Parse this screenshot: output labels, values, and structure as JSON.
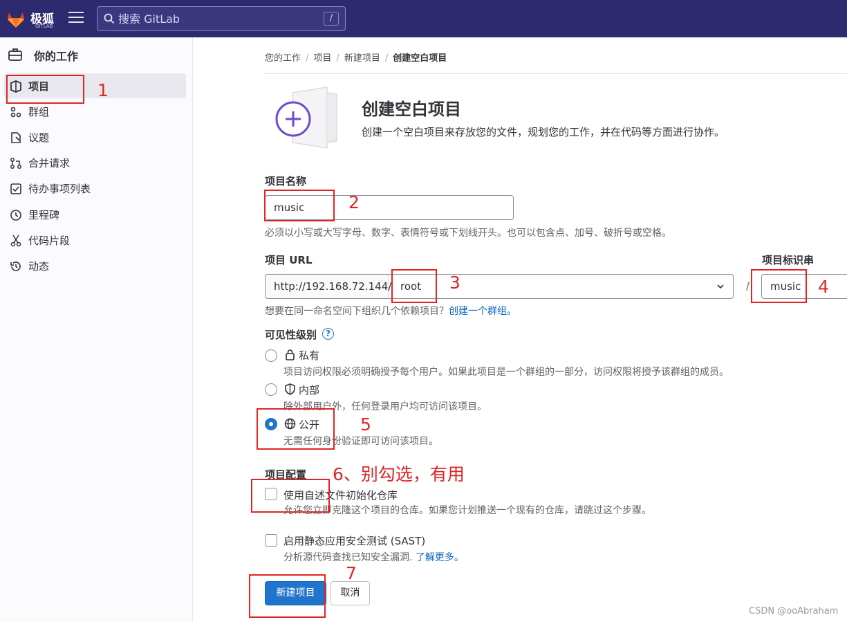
{
  "topbar": {
    "brand": "极狐",
    "brand_sub": "GITLAB",
    "search_placeholder": "搜索 GitLab",
    "search_shortcut": "/"
  },
  "sidebar": {
    "title": "你的工作",
    "items": [
      {
        "label": "项目",
        "icon": "project-icon",
        "active": true
      },
      {
        "label": "群组",
        "icon": "group-icon"
      },
      {
        "label": "议题",
        "icon": "issues-icon"
      },
      {
        "label": "合并请求",
        "icon": "merge-request-icon"
      },
      {
        "label": "待办事项列表",
        "icon": "todo-icon"
      },
      {
        "label": "里程碑",
        "icon": "milestone-icon"
      },
      {
        "label": "代码片段",
        "icon": "snippet-icon"
      },
      {
        "label": "动态",
        "icon": "history-icon"
      }
    ]
  },
  "breadcrumb": [
    "您的工作",
    "项目",
    "新建项目",
    "创建空白项目"
  ],
  "page": {
    "title": "创建空白项目",
    "description": "创建一个空白项目来存放您的文件，规划您的工作，并在代码等方面进行协作。"
  },
  "form": {
    "name_label": "项目名称",
    "name_value": "music",
    "name_help": "必须以小写或大写字母、数字、表情符号或下划线开头。也可以包含点、加号、破折号或空格。",
    "url_label": "项目 URL",
    "url_prefix": "http://192.168.72.144/",
    "url_namespace": "root",
    "url_separator": "/",
    "slug_label": "项目标识串",
    "slug_value": "music",
    "url_help": "想要在同一命名空间下组织几个依赖项目？",
    "url_help_link": "创建一个群组。",
    "visibility_label": "可见性级别",
    "visibility_help_icon": "?",
    "visibility": [
      {
        "label": "私有",
        "icon": "lock-icon",
        "desc": "项目访问权限必须明确授予每个用户。如果此项目是一个群组的一部分，访问权限将授予该群组的成员。",
        "checked": false
      },
      {
        "label": "内部",
        "icon": "shield-icon",
        "desc": "除外部用户外，任何登录用户均可访问该项目。",
        "checked": false
      },
      {
        "label": "公开",
        "icon": "globe-icon",
        "desc": "无需任何身份验证即可访问该项目。",
        "checked": true
      }
    ],
    "config_label": "项目配置",
    "init_readme_label": "使用自述文件初始化仓库",
    "init_readme_desc": "允许您立即克隆这个项目的仓库。如果您计划推送一个现有的仓库，请跳过这个步骤。",
    "init_readme_checked": false,
    "sast_label": "启用静态应用安全测试 (SAST)",
    "sast_desc": "分析源代码查找已知安全漏洞.",
    "sast_link": "了解更多。",
    "sast_checked": false,
    "submit_label": "新建项目",
    "cancel_label": "取消"
  },
  "annotations": [
    "1",
    "2",
    "3",
    "4",
    "5",
    "6、别勾选，有用",
    "7"
  ],
  "watermark": "CSDN @ooAbraham",
  "colors": {
    "topbar": "#2e2a70",
    "primary": "#1f75cb",
    "annotation": "#e02424",
    "illustration": "#6e49cb"
  }
}
